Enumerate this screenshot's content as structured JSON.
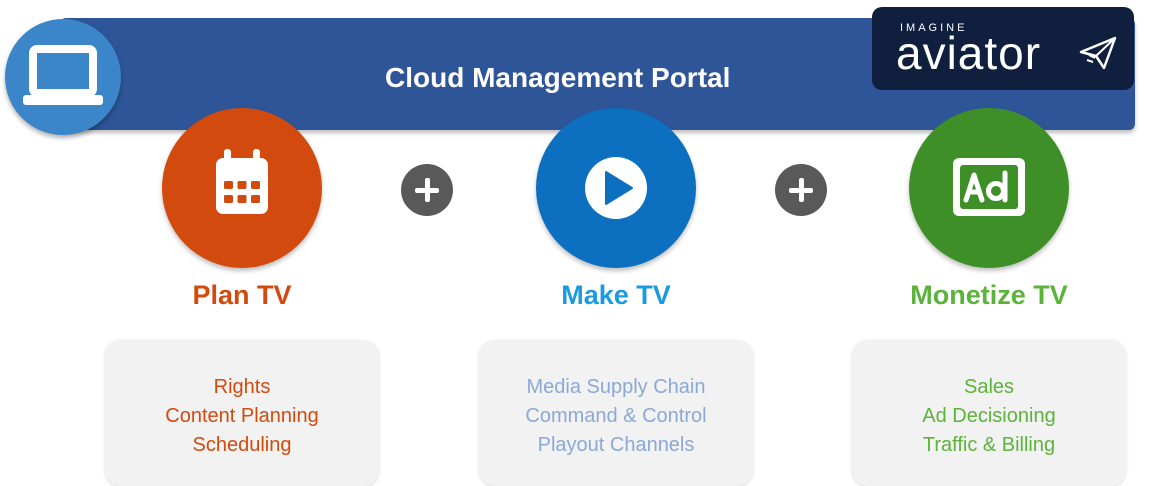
{
  "banner": {
    "title": "Cloud Management Portal"
  },
  "logo": {
    "brand_small": "IMAGINE",
    "brand_big": "aviator"
  },
  "pillars": [
    {
      "title": "Plan TV",
      "icon": "calendar-icon",
      "color": "#d24a0d",
      "text_color": "#d24a0d",
      "items": [
        "Rights",
        "Content Planning",
        "Scheduling"
      ]
    },
    {
      "title": "Make TV",
      "icon": "play-icon",
      "color": "#0d6fbf",
      "text_color": "#1a9ae0",
      "items": [
        "Media Supply Chain",
        "Command & Control",
        "Playout Channels"
      ]
    },
    {
      "title": "Monetize TV",
      "icon": "ad-icon",
      "color": "#3f8f28",
      "text_color": "#5cb33a",
      "items": [
        "Sales",
        "Ad Decisioning",
        "Traffic & Billing"
      ]
    }
  ],
  "colors": {
    "banner": "#2e5597",
    "laptop_circle": "#3b86c8",
    "logo_bg": "#0f1f3d",
    "plus": "#595959",
    "make_items": "#8aa8d8"
  }
}
